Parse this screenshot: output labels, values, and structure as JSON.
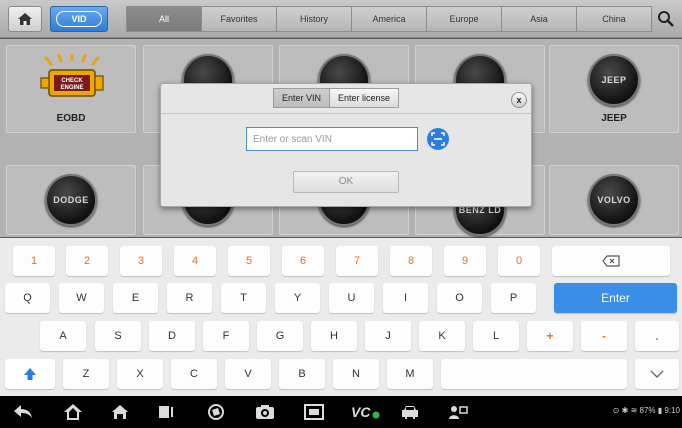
{
  "topbar": {
    "vid_label": "VID",
    "tabs": [
      {
        "label": "All",
        "active": true
      },
      {
        "label": "Favorites",
        "active": false
      },
      {
        "label": "History",
        "active": false
      },
      {
        "label": "America",
        "active": false
      },
      {
        "label": "Europe",
        "active": false
      },
      {
        "label": "Asia",
        "active": false
      },
      {
        "label": "China",
        "active": false
      }
    ]
  },
  "vehicles": {
    "row1": [
      {
        "name": "EOBD",
        "logo": "CHECK ENGINE"
      },
      {
        "name": "JEEP",
        "logo": "JEEP"
      }
    ],
    "row2": [
      {
        "logo": "DODGE"
      },
      {
        "logo": "BENZ LD"
      },
      {
        "logo": "VOLVO"
      }
    ]
  },
  "dialog": {
    "tabs": [
      "Enter VIN",
      "Enter license"
    ],
    "active_tab": "Enter VIN",
    "close_label": "x",
    "vin_placeholder": "Enter or scan VIN",
    "ok_label": "OK"
  },
  "keyboard": {
    "numbers": [
      "1",
      "2",
      "3",
      "4",
      "5",
      "6",
      "7",
      "8",
      "9",
      "0"
    ],
    "row_q": [
      "Q",
      "W",
      "E",
      "R",
      "T",
      "Y",
      "U",
      "I",
      "O",
      "P"
    ],
    "enter_label": "Enter",
    "row_a": [
      "A",
      "S",
      "D",
      "F",
      "G",
      "H",
      "J",
      "K",
      "L",
      "+",
      "-",
      "."
    ],
    "row_z": [
      "Z",
      "X",
      "C",
      "V",
      "B",
      "N",
      "M"
    ]
  },
  "statusbar": {
    "battery": "87%",
    "time": "9:10"
  },
  "colors": {
    "accent_blue": "#3a8ee6",
    "number_orange": "#e2722d"
  }
}
